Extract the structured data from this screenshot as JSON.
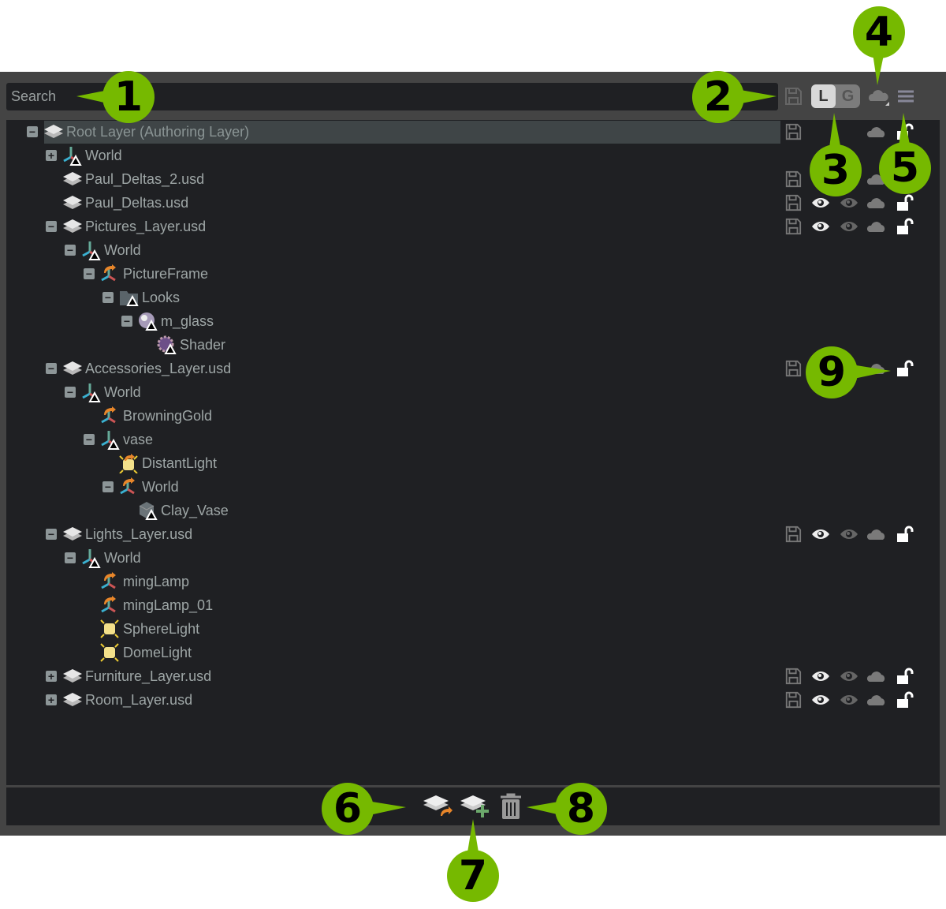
{
  "search": {
    "placeholder": "Search"
  },
  "toolbar": {
    "local_label": "L",
    "global_label": "G",
    "icons": [
      "save-icon",
      "cloud-icon",
      "menu-icon"
    ]
  },
  "colors": {
    "accent": "#76b900",
    "panel": "#444444",
    "tree_bg": "#1f2023",
    "text": "#9ea6a6"
  },
  "tree": [
    {
      "label": "Root Layer (Authoring Layer)",
      "level": 0,
      "exp": "-",
      "icon": "layer",
      "right": "root",
      "selected": true
    },
    {
      "label": "World",
      "level": 1,
      "exp": "+",
      "icon": "xform"
    },
    {
      "label": "Paul_Deltas_2.usd",
      "level": 1,
      "exp": "",
      "icon": "layer",
      "right": "layer"
    },
    {
      "label": "Paul_Deltas.usd",
      "level": 1,
      "exp": "",
      "icon": "layer",
      "right": "layer"
    },
    {
      "label": "Pictures_Layer.usd",
      "level": 1,
      "exp": "-",
      "icon": "layer",
      "right": "layer"
    },
    {
      "label": "World",
      "level": 2,
      "exp": "-",
      "icon": "xform"
    },
    {
      "label": "PictureFrame",
      "level": 3,
      "exp": "-",
      "icon": "xform-ref"
    },
    {
      "label": "Looks",
      "level": 4,
      "exp": "-",
      "icon": "folder"
    },
    {
      "label": "m_glass",
      "level": 5,
      "exp": "-",
      "icon": "material"
    },
    {
      "label": "Shader",
      "level": 6,
      "exp": "",
      "icon": "shader"
    },
    {
      "label": "Accessories_Layer.usd",
      "level": 1,
      "exp": "-",
      "icon": "layer",
      "right": "layer"
    },
    {
      "label": "World",
      "level": 2,
      "exp": "-",
      "icon": "xform"
    },
    {
      "label": "BrowningGold",
      "level": 3,
      "exp": "",
      "icon": "xform-ref"
    },
    {
      "label": "vase",
      "level": 3,
      "exp": "-",
      "icon": "xform"
    },
    {
      "label": "DistantLight",
      "level": 4,
      "exp": "",
      "icon": "distant-light"
    },
    {
      "label": "World",
      "level": 4,
      "exp": "-",
      "icon": "xform-ref"
    },
    {
      "label": "Clay_Vase",
      "level": 5,
      "exp": "",
      "icon": "mesh"
    },
    {
      "label": "Lights_Layer.usd",
      "level": 1,
      "exp": "-",
      "icon": "layer",
      "right": "layer"
    },
    {
      "label": "World",
      "level": 2,
      "exp": "-",
      "icon": "xform"
    },
    {
      "label": "mingLamp",
      "level": 3,
      "exp": "",
      "icon": "xform-ref"
    },
    {
      "label": "mingLamp_01",
      "level": 3,
      "exp": "",
      "icon": "xform-ref"
    },
    {
      "label": "SphereLight",
      "level": 3,
      "exp": "",
      "icon": "light"
    },
    {
      "label": "DomeLight",
      "level": 3,
      "exp": "",
      "icon": "light"
    },
    {
      "label": "Furniture_Layer.usd",
      "level": 1,
      "exp": "+",
      "icon": "layer",
      "right": "layer"
    },
    {
      "label": "Room_Layer.usd",
      "level": 1,
      "exp": "+",
      "icon": "layer",
      "right": "layer"
    }
  ],
  "bottom": {
    "icons": [
      "insert-sublayer-icon",
      "create-sublayer-icon",
      "delete-icon"
    ]
  },
  "callouts": [
    "1",
    "2",
    "3",
    "4",
    "5",
    "6",
    "7",
    "8",
    "9"
  ]
}
